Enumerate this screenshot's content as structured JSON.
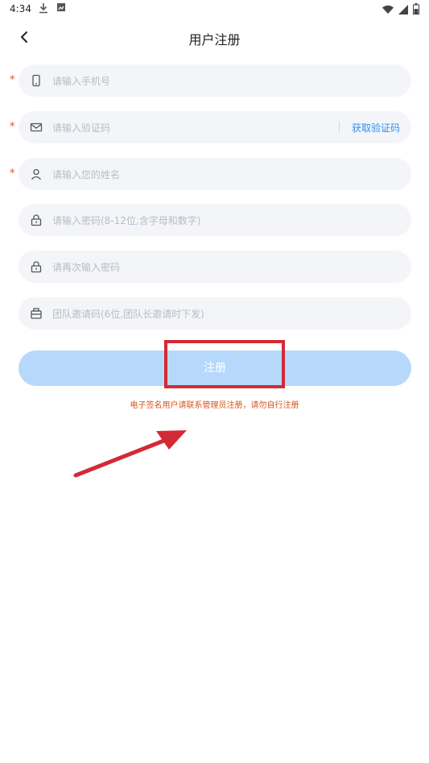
{
  "status_bar": {
    "time": "4:34",
    "left_icons": [
      "download-icon",
      "image-notification-icon"
    ],
    "right_icons": [
      "wifi-icon",
      "signal-icon",
      "battery-icon"
    ]
  },
  "header": {
    "title": "用户注册",
    "back_icon": "chevron-left-icon"
  },
  "form": {
    "phone": {
      "placeholder": "请输入手机号",
      "required": "*",
      "icon": "phone-icon"
    },
    "code": {
      "placeholder": "请输入验证码",
      "required": "*",
      "icon": "mail-icon",
      "button_label": "获取验证码"
    },
    "name": {
      "placeholder": "请输入您的姓名",
      "required": "*",
      "icon": "user-icon"
    },
    "password": {
      "placeholder": "请输入密码(8-12位,含字母和数字)",
      "icon": "lock-icon"
    },
    "confirm_password": {
      "placeholder": "请再次输入密码",
      "icon": "lock-icon"
    },
    "team_code": {
      "placeholder": "团队邀请码(6位,团队长邀请时下发)",
      "icon": "team-card-icon"
    }
  },
  "register_button": {
    "label": "注册"
  },
  "notice": "电子签名用户请联系管理员注册，请勿自行注册",
  "colors": {
    "accent": "#2f8ef2",
    "button_bg": "#b6d9fb",
    "field_bg": "#f3f5f9",
    "required": "#e4502e",
    "notice": "#d9541a",
    "annotation": "#d32a35"
  }
}
